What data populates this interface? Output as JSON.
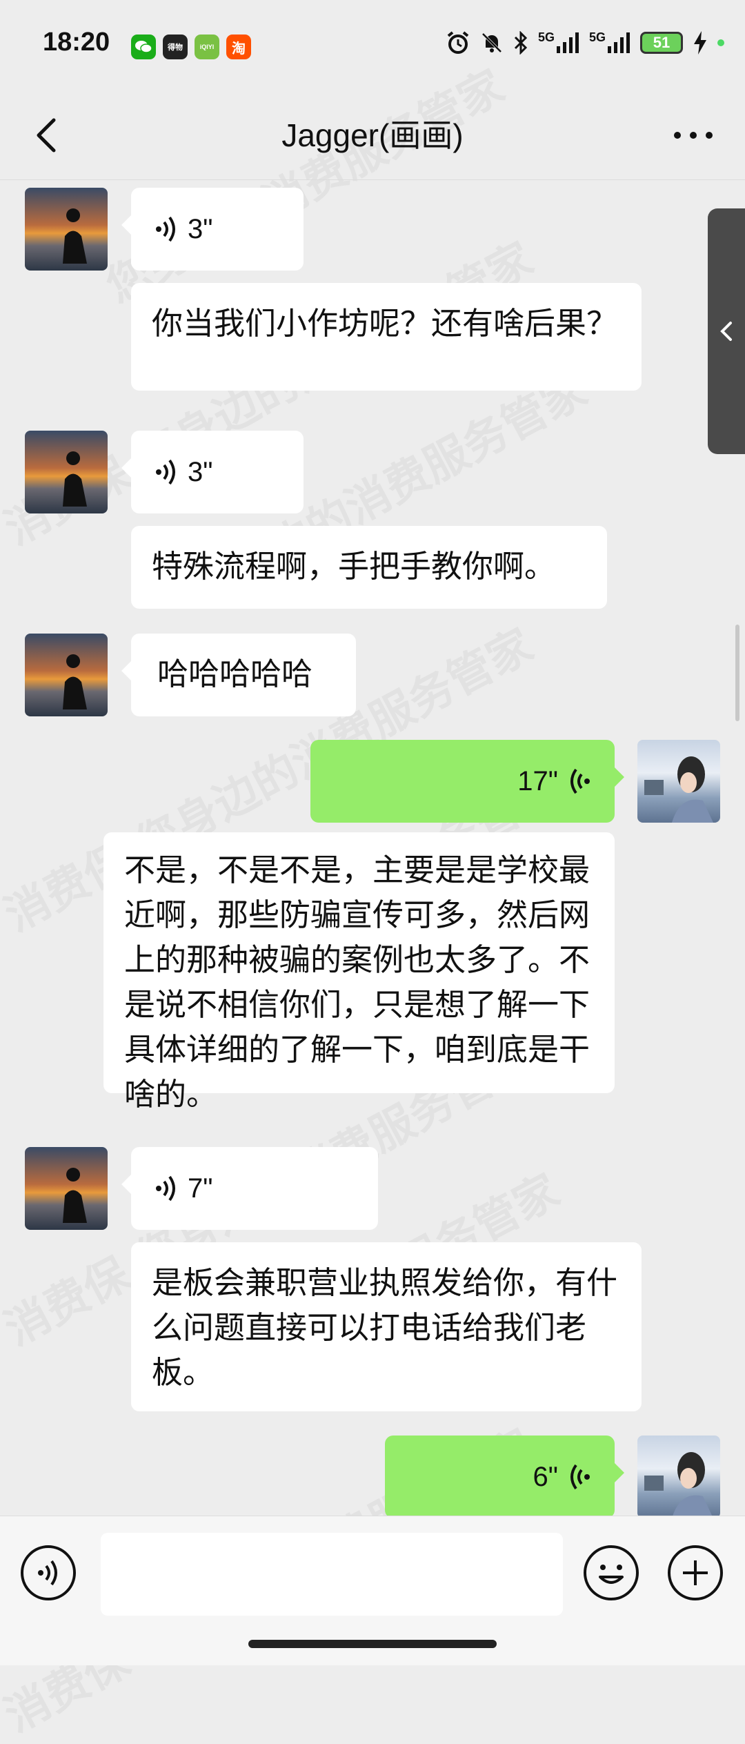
{
  "status_bar": {
    "time": "18:20",
    "app_icons": [
      {
        "name": "wechat-icon",
        "color": "#1aad19",
        "label": ""
      },
      {
        "name": "dewu-icon",
        "color": "#222222",
        "label": "得物"
      },
      {
        "name": "iqiyi-icon",
        "color": "#7ac143",
        "label": "iQIYI"
      },
      {
        "name": "taobao-icon",
        "color": "#ff5000",
        "label": "淘"
      }
    ],
    "network1": "5G",
    "network2": "5G",
    "battery": "51"
  },
  "nav": {
    "title": "Jagger(画画)"
  },
  "messages": [
    {
      "kind": "voice-in",
      "duration": "3\""
    },
    {
      "kind": "text-in",
      "text": "你当我们小作坊呢？还有啥后果？"
    },
    {
      "kind": "voice-in",
      "duration": "3\""
    },
    {
      "kind": "text-in",
      "text": "特殊流程啊，手把手教你啊。"
    },
    {
      "kind": "text-in",
      "text": "哈哈哈哈哈"
    },
    {
      "kind": "voice-out",
      "duration": "17\""
    },
    {
      "kind": "text-out-white",
      "text": "不是，不是不是，主要是是学校最近啊，那些防骗宣传可多，然后网上的那种被骗的案例也太多了。不是说不相信你们，只是想了解一下具体详细的了解一下，咱到底是干啥的。"
    },
    {
      "kind": "voice-in",
      "duration": "7\""
    },
    {
      "kind": "text-in",
      "text": "是板会兼职营业执照发给你，有什么问题直接可以打电话给我们老板。"
    },
    {
      "kind": "voice-out",
      "duration": "6\""
    }
  ],
  "watermark": {
    "text": "您身边的消费服务管家",
    "text2": "消费保 您身边的消费服务管家"
  },
  "colors": {
    "bubble_green": "#95ec69",
    "bubble_white": "#ffffff",
    "background": "#ededed"
  }
}
